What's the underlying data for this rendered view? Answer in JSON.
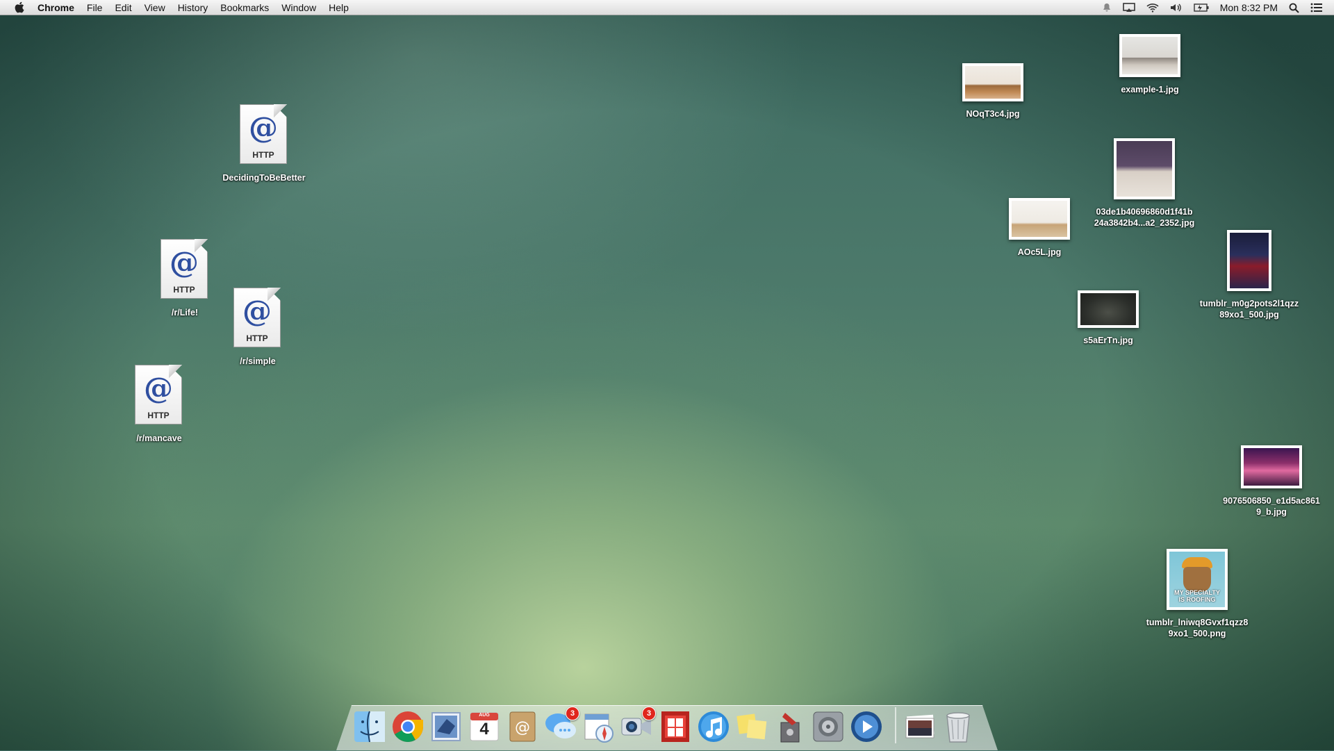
{
  "menubar": {
    "app_name": "Chrome",
    "items": [
      "File",
      "Edit",
      "View",
      "History",
      "Bookmarks",
      "Window",
      "Help"
    ],
    "clock": "Mon 8:32 PM",
    "status_icons": [
      "notification-icon",
      "airplay-icon",
      "wifi-icon",
      "volume-icon",
      "battery-icon",
      "spotlight-icon",
      "notification-center-icon"
    ]
  },
  "desktop": {
    "http_files": [
      {
        "name": "DecidingToBeBetter",
        "badge": "HTTP"
      },
      {
        "name": "/r/Life!",
        "badge": "HTTP"
      },
      {
        "name": "/r/simple",
        "badge": "HTTP"
      },
      {
        "name": "/r/mancave",
        "badge": "HTTP"
      }
    ],
    "images": [
      {
        "line1": "example-1.jpg",
        "line2": ""
      },
      {
        "line1": "NOqT3c4.jpg",
        "line2": ""
      },
      {
        "line1": "03de1b40696860d1f41b",
        "line2": "24a3842b4...a2_2352.jpg"
      },
      {
        "line1": "AOc5L.jpg",
        "line2": ""
      },
      {
        "line1": "tumblr_m0g2pots2l1qzz",
        "line2": "89xo1_500.jpg"
      },
      {
        "line1": "s5aErTn.jpg",
        "line2": ""
      },
      {
        "line1": "9076506850_e1d5ac861",
        "line2": "9_b.jpg"
      },
      {
        "line1": "tumblr_lniwq8Gvxf1qzz8",
        "line2": "9xo1_500.png",
        "caption_line1": "MY SPECIALTY",
        "caption_line2": "IS ROOFING"
      }
    ]
  },
  "dock": {
    "items": [
      "finder",
      "chrome",
      "mail",
      "calendar",
      "contacts",
      "messages",
      "safari",
      "facetime",
      "photo-booth",
      "itunes",
      "stickies",
      "migration",
      "system-preferences",
      "quicktime",
      "photos-stack",
      "trash"
    ],
    "calendar_day": "4",
    "calendar_month": "AUG",
    "messages_badge": "3",
    "facetime_badge": "3"
  }
}
